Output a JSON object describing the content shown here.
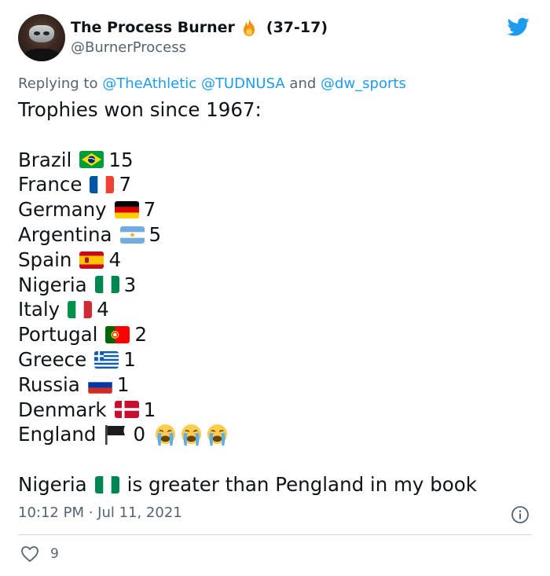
{
  "author": {
    "display_name": "The Process Burner",
    "record": "(37-17)",
    "handle": "@BurnerProcess",
    "name_emoji": "fire-emoji",
    "avatar": "profile-photo"
  },
  "reply": {
    "prefix": "Replying to",
    "mention_1": "@TheAthletic",
    "mention_2": "@TUDNUSA",
    "and": "and",
    "mention_3": "@dw_sports"
  },
  "tweet": {
    "heading": "Trophies won since 1967:",
    "rows": [
      {
        "country": "Brazil",
        "flag": "brazil-flag-icon",
        "value": "15"
      },
      {
        "country": "France",
        "flag": "france-flag-icon",
        "value": "7"
      },
      {
        "country": "Germany",
        "flag": "germany-flag-icon",
        "value": "7"
      },
      {
        "country": "Argentina",
        "flag": "argentina-flag-icon",
        "value": "5"
      },
      {
        "country": "Spain",
        "flag": "spain-flag-icon",
        "value": "4"
      },
      {
        "country": "Nigeria",
        "flag": "nigeria-flag-icon",
        "value": "3"
      },
      {
        "country": "Italy",
        "flag": "italy-flag-icon",
        "value": "4"
      },
      {
        "country": "Portugal",
        "flag": "portugal-flag-icon",
        "value": "2"
      },
      {
        "country": "Greece",
        "flag": "greece-flag-icon",
        "value": "1"
      },
      {
        "country": "Russia",
        "flag": "russia-flag-icon",
        "value": "1"
      },
      {
        "country": "Denmark",
        "flag": "denmark-flag-icon",
        "value": "1"
      },
      {
        "country": "England",
        "flag": "black-flag-icon",
        "value": "0",
        "extra": "crying-face-emoji x3"
      }
    ],
    "closing_prefix": "Nigeria",
    "closing_flag": "nigeria-flag-icon",
    "closing_suffix": "is greater than Pengland in my book"
  },
  "meta": {
    "timestamp": "10:12 PM · Jul 11, 2021",
    "like_count": "9",
    "like_icon": "heart-icon",
    "info_icon": "info-icon",
    "brand_icon": "twitter-bird-icon"
  },
  "colors": {
    "text": "#0f1419",
    "secondary": "#536471",
    "link": "#1d9bf0",
    "divider": "#cfd9de"
  }
}
